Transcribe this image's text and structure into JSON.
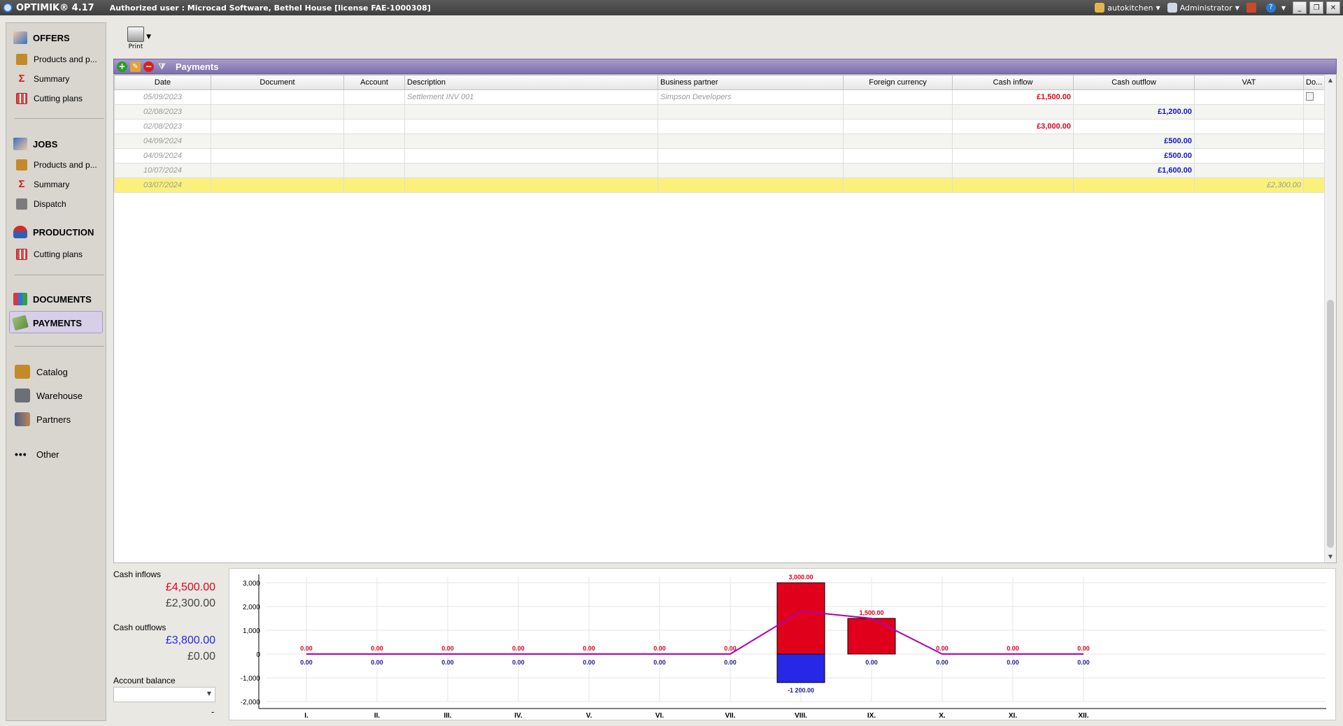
{
  "titlebar": {
    "app_name": "OPTIMIK® 4.17",
    "authorized": "Authorized user :  Microcad Software, Bethel House  [license FAE-1000308]",
    "project": "autokitchen",
    "user": "Administrator"
  },
  "sidebar": {
    "offers": {
      "title": "OFFERS",
      "items": [
        "Products and p...",
        "Summary",
        "Cutting plans"
      ]
    },
    "jobs": {
      "title": "JOBS",
      "items": [
        "Products and p...",
        "Summary",
        "Dispatch"
      ]
    },
    "production": {
      "title": "PRODUCTION",
      "items": [
        "Cutting plans"
      ]
    },
    "documents": "DOCUMENTS",
    "payments": "PAYMENTS",
    "catalog": "Catalog",
    "warehouse": "Warehouse",
    "partners": "Partners",
    "other": "Other"
  },
  "toolbar": {
    "print_label": "Print"
  },
  "panel": {
    "title": "Payments"
  },
  "table": {
    "headers": [
      "Date",
      "Document",
      "Account",
      "Description",
      "Business partner",
      "Foreign currency",
      "Cash inflow",
      "Cash outflow",
      "VAT",
      "Do..."
    ],
    "rows": [
      {
        "date": "05/09/2023",
        "document": "",
        "account": "",
        "description": "Settlement INV 001",
        "partner": "Simpson Developers",
        "foreign": "",
        "inflow": "£1,500.00",
        "outflow": "",
        "vat": ""
      },
      {
        "date": "02/08/2023",
        "document": "",
        "account": "",
        "description": "",
        "partner": "",
        "foreign": "",
        "inflow": "",
        "outflow": "£1,200.00",
        "vat": ""
      },
      {
        "date": "02/08/2023",
        "document": "",
        "account": "",
        "description": "",
        "partner": "",
        "foreign": "",
        "inflow": "£3,000.00",
        "outflow": "",
        "vat": ""
      },
      {
        "date": "04/09/2024",
        "document": "",
        "account": "",
        "description": "",
        "partner": "",
        "foreign": "",
        "inflow": "",
        "outflow": "£500.00",
        "vat": ""
      },
      {
        "date": "04/09/2024",
        "document": "",
        "account": "",
        "description": "",
        "partner": "",
        "foreign": "",
        "inflow": "",
        "outflow": "£500.00",
        "vat": ""
      },
      {
        "date": "10/07/2024",
        "document": "",
        "account": "",
        "description": "",
        "partner": "",
        "foreign": "",
        "inflow": "",
        "outflow": "£1,600.00",
        "vat": ""
      },
      {
        "date": "03/07/2024",
        "document": "",
        "account": "",
        "description": "",
        "partner": "",
        "foreign": "",
        "inflow": "",
        "outflow": "",
        "vat": "£2,300.00"
      }
    ]
  },
  "summary": {
    "inflows_label": "Cash inflows",
    "inflows_value": "£4,500.00",
    "inflows_vat": "£2,300.00",
    "outflows_label": "Cash outflows",
    "outflows_value": "£3,800.00",
    "outflows_vat": "£0.00",
    "balance_label": "Account balance",
    "balance_value": "-"
  },
  "colors": {
    "inflow": "#e0001b",
    "outflow": "#2727e6",
    "line": "#b000b0",
    "header": "#8a7db8",
    "selected_row": "#faf17c"
  },
  "chart_data": {
    "type": "bar",
    "categories": [
      "I.",
      "II.",
      "III.",
      "IV.",
      "V.",
      "VI.",
      "VII.",
      "VIII.",
      "IX.",
      "X.",
      "XI.",
      "XII."
    ],
    "series": [
      {
        "values": [
          0,
          0,
          0,
          0,
          0,
          0,
          0,
          3000,
          1500,
          0,
          0,
          0
        ]
      },
      {
        "values": [
          0,
          0,
          0,
          0,
          0,
          0,
          0,
          -1200,
          0,
          0,
          0,
          0
        ]
      },
      {
        "type": "line",
        "values": [
          0,
          0,
          0,
          0,
          0,
          0,
          0,
          1800,
          1500,
          0,
          0,
          0
        ]
      }
    ],
    "inflow_labels": [
      "0.00",
      "0.00",
      "0.00",
      "0.00",
      "0.00",
      "0.00",
      "0.00",
      "3,000.00",
      "1,500.00",
      "0.00",
      "0.00",
      "0.00"
    ],
    "outflow_labels": [
      "0.00",
      "0.00",
      "0.00",
      "0.00",
      "0.00",
      "0.00",
      "0.00",
      "-1 200.00",
      "0.00",
      "0.00",
      "0.00",
      "0.00"
    ],
    "yticks": [
      "3,000",
      "2,000",
      "1,000",
      "0",
      "-1,000",
      "-2,000"
    ],
    "ylim": [
      -2000,
      3000
    ],
    "grid": true
  }
}
